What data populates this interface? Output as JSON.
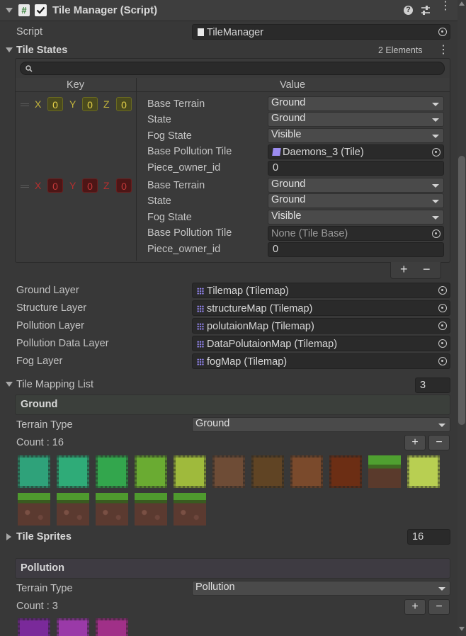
{
  "component": {
    "title": "Tile Manager (Script)",
    "script_label": "Script",
    "script_value": "TileManager"
  },
  "tile_states": {
    "label": "Tile States",
    "count_text": "2 Elements",
    "search_placeholder": "",
    "key_header": "Key",
    "value_header": "Value",
    "entries": [
      {
        "axis_x": "X",
        "axis_y": "Y",
        "axis_z": "Z",
        "x": "0",
        "y": "0",
        "z": "0",
        "valid": true,
        "base_terrain_label": "Base Terrain",
        "base_terrain": "Ground",
        "state_label": "State",
        "state": "Ground",
        "fog_state_label": "Fog State",
        "fog_state": "Visible",
        "pollution_tile_label": "Base Pollution Tile",
        "pollution_tile": "Daemons_3 (Tile)",
        "owner_label": "Piece_owner_id",
        "owner": "0"
      },
      {
        "axis_x": "X",
        "axis_y": "Y",
        "axis_z": "Z",
        "x": "0",
        "y": "0",
        "z": "0",
        "valid": false,
        "base_terrain_label": "Base Terrain",
        "base_terrain": "Ground",
        "state_label": "State",
        "state": "Ground",
        "fog_state_label": "Fog State",
        "fog_state": "Visible",
        "pollution_tile_label": "Base Pollution Tile",
        "pollution_tile": "None (Tile Base)",
        "owner_label": "Piece_owner_id",
        "owner": "0"
      }
    ],
    "add_label": "+",
    "remove_label": "−"
  },
  "layers": [
    {
      "label": "Ground Layer",
      "value": "Tilemap (Tilemap)"
    },
    {
      "label": "Structure Layer",
      "value": "structureMap (Tilemap)"
    },
    {
      "label": "Pollution Layer",
      "value": "polutaionMap (Tilemap)"
    },
    {
      "label": "Pollution Data Layer",
      "value": "DataPolutaionMap (Tilemap)"
    },
    {
      "label": "Fog Layer",
      "value": "fogMap (Tilemap)"
    }
  ],
  "tile_mapping": {
    "label": "Tile Mapping List",
    "size": "3",
    "groups": [
      {
        "header": "Ground",
        "terrain_label": "Terrain Type",
        "terrain_value": "Ground",
        "count_text": "Count : 16",
        "add_label": "+",
        "remove_label": "−",
        "sprites_label": "Tile Sprites",
        "sprites_size": "16",
        "tile_colors": [
          "#2fa27a",
          "#2fab78",
          "#33a64d",
          "#6aab32",
          "#9fba3c",
          "#6e4c36",
          "#604424",
          "#7a4a2c",
          "#6c2e14",
          "grass",
          "#b8cf52",
          "soil",
          "soil",
          "soil",
          "soil",
          "soil"
        ]
      },
      {
        "header": "Pollution",
        "terrain_label": "Terrain Type",
        "terrain_value": "Pollution",
        "count_text": "Count : 3",
        "add_label": "+",
        "remove_label": "−",
        "tile_colors": [
          "#7a2a9a",
          "#9a3aa8",
          "#a03088"
        ]
      }
    ]
  },
  "colors": {
    "background": "#383838",
    "field": "#2a2a2a",
    "dropdown": "#4a4a4a",
    "valid_coord": "#e6d24a",
    "invalid_coord": "#c53a3a"
  }
}
